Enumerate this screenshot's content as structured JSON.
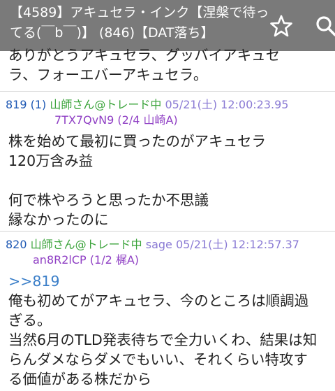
{
  "header": {
    "title_line1": "【4589】アキュセラ・インク【涅槃で待っ",
    "title_line2": "てる(￣b￣)】 (846)【DAT落ち】"
  },
  "posts": [
    {
      "lines": [
        "ありがとうアキュセラ、グッバイアキュセ",
        "ラ、フォーエバーアキュセラ。"
      ]
    },
    {
      "number": "819 (1)",
      "name": "山師さん@トレード中",
      "date": "05/21(土) 12:00:23.95",
      "id": "7TX7QvN9 (2/4 山崎A)",
      "lines": [
        "株を始めて最初に買ったのがアキュセラ",
        "120万含み益",
        "",
        "何で株やろうと思ったか不思議",
        "縁なかったのに"
      ]
    },
    {
      "number": "820",
      "name": "山師さん@トレード中",
      "mail": "sage",
      "date": "05/21(土) 12:12:57.37",
      "id": "an8R2lCP (1/2 梶A)",
      "anchor": ">>819",
      "lines": [
        "俺も初めてがアキュセラ、今のところは順調過",
        "ぎる。",
        "当然6月のTLD発表待ちで全力いくわ、結果は知",
        "らんダメならダメでもいい、それくらい特攻す",
        "る価値がある株だから"
      ]
    }
  ],
  "icons": {
    "favorite": "star-outline-icon",
    "search": "search-icon"
  },
  "colors": {
    "appbar": "#7a7a7a",
    "link": "#3a7ec8",
    "id": "#8f3fc4"
  }
}
